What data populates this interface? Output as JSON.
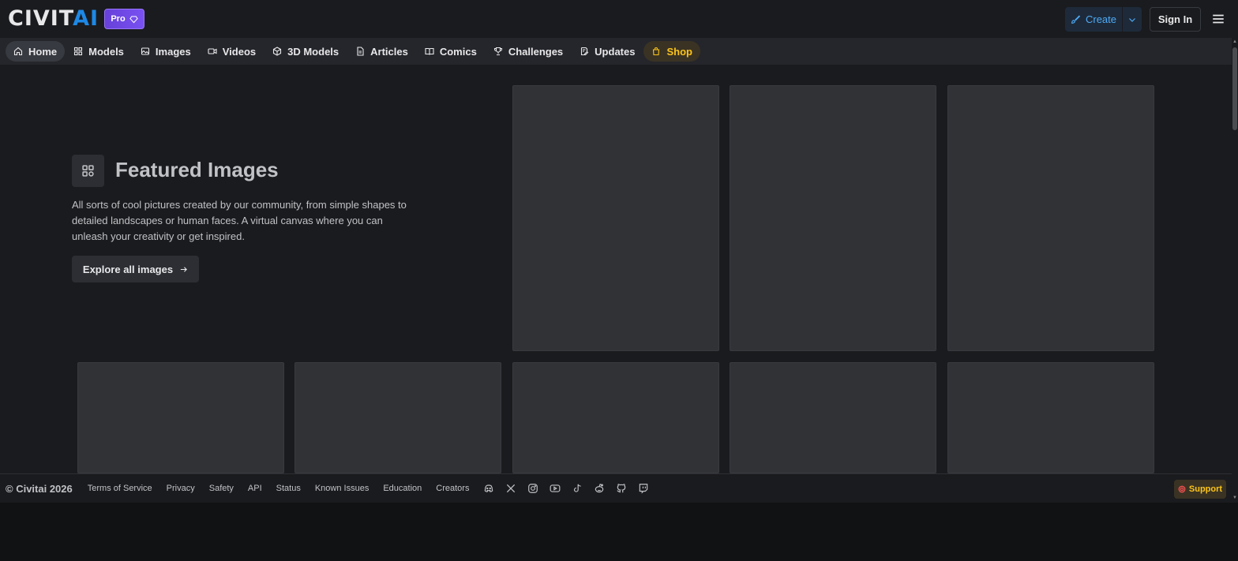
{
  "header": {
    "logo_main": "CIVIT",
    "logo_accent": "AI",
    "pro_label": "Pro",
    "create_label": "Create",
    "signin_label": "Sign In"
  },
  "nav": {
    "items": [
      {
        "label": "Home",
        "icon": "home-icon"
      },
      {
        "label": "Models",
        "icon": "grid-icon"
      },
      {
        "label": "Images",
        "icon": "photo-icon"
      },
      {
        "label": "Videos",
        "icon": "video-icon"
      },
      {
        "label": "3D Models",
        "icon": "cube-icon"
      },
      {
        "label": "Articles",
        "icon": "article-icon"
      },
      {
        "label": "Comics",
        "icon": "book-icon"
      },
      {
        "label": "Challenges",
        "icon": "trophy-icon"
      },
      {
        "label": "Updates",
        "icon": "updates-icon"
      },
      {
        "label": "Shop",
        "icon": "shopping-bag-icon"
      }
    ]
  },
  "hero": {
    "title": "Featured Images",
    "description": "All sorts of cool pictures created by our community, from simple shapes to detailed landscapes or human faces. A virtual canvas where you can unleash your creativity or get inspired.",
    "cta_label": "Explore all images"
  },
  "footer": {
    "copyright": "© Civitai 2026",
    "links": [
      "Terms of Service",
      "Privacy",
      "Safety",
      "API",
      "Status",
      "Known Issues",
      "Education",
      "Creators"
    ],
    "social_icons": [
      "discord-icon",
      "x-icon",
      "instagram-icon",
      "youtube-icon",
      "tiktok-icon",
      "reddit-icon",
      "github-icon",
      "twitch-icon"
    ],
    "support_label": "Support"
  },
  "colors": {
    "background": "#1a1b1e",
    "nav_background": "#25262b",
    "accent_blue": "#4dabf7",
    "pro_purple": "#7950f2",
    "shop_yellow": "#fcc419"
  }
}
